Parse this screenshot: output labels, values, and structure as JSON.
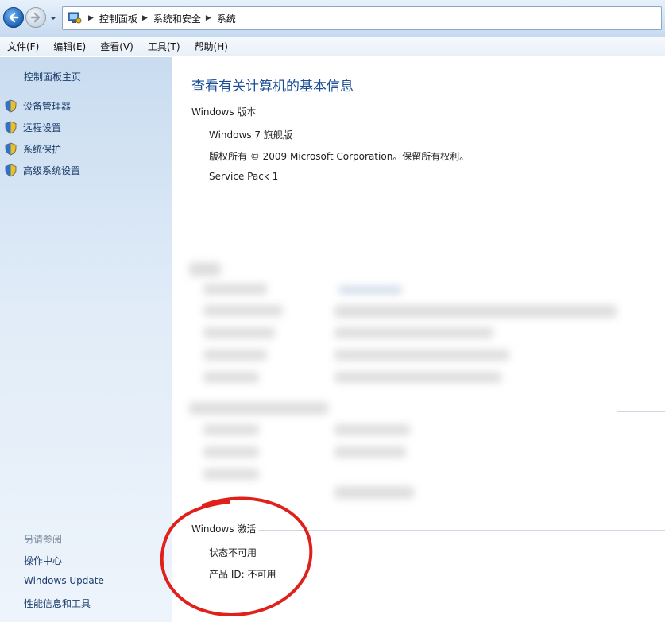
{
  "breadcrumbs": [
    "控制面板",
    "系统和安全",
    "系统"
  ],
  "menu": [
    "文件(F)",
    "编辑(E)",
    "查看(V)",
    "工具(T)",
    "帮助(H)"
  ],
  "sidebar": {
    "home": "控制面板主页",
    "links": [
      "设备管理器",
      "远程设置",
      "系统保护",
      "高级系统设置"
    ],
    "see_also_title": "另请参阅",
    "see_also": [
      "操作中心",
      "Windows Update",
      "性能信息和工具"
    ]
  },
  "main": {
    "heading": "查看有关计算机的基本信息",
    "edition": {
      "title": "Windows 版本",
      "name": "Windows 7 旗舰版",
      "copyright": "版权所有 © 2009 Microsoft Corporation。保留所有权利。",
      "service_pack": "Service Pack 1"
    },
    "activation": {
      "title": "Windows 激活",
      "status": "状态不可用",
      "product_id": "产品 ID: 不可用"
    }
  },
  "colors": {
    "link": "#1b3d6b",
    "heading": "#1a4f96",
    "annotation": "#e0201a"
  },
  "icons": [
    "back-arrow-icon",
    "forward-arrow-icon",
    "history-dropdown-icon",
    "control-panel-icon",
    "shield-icon"
  ]
}
